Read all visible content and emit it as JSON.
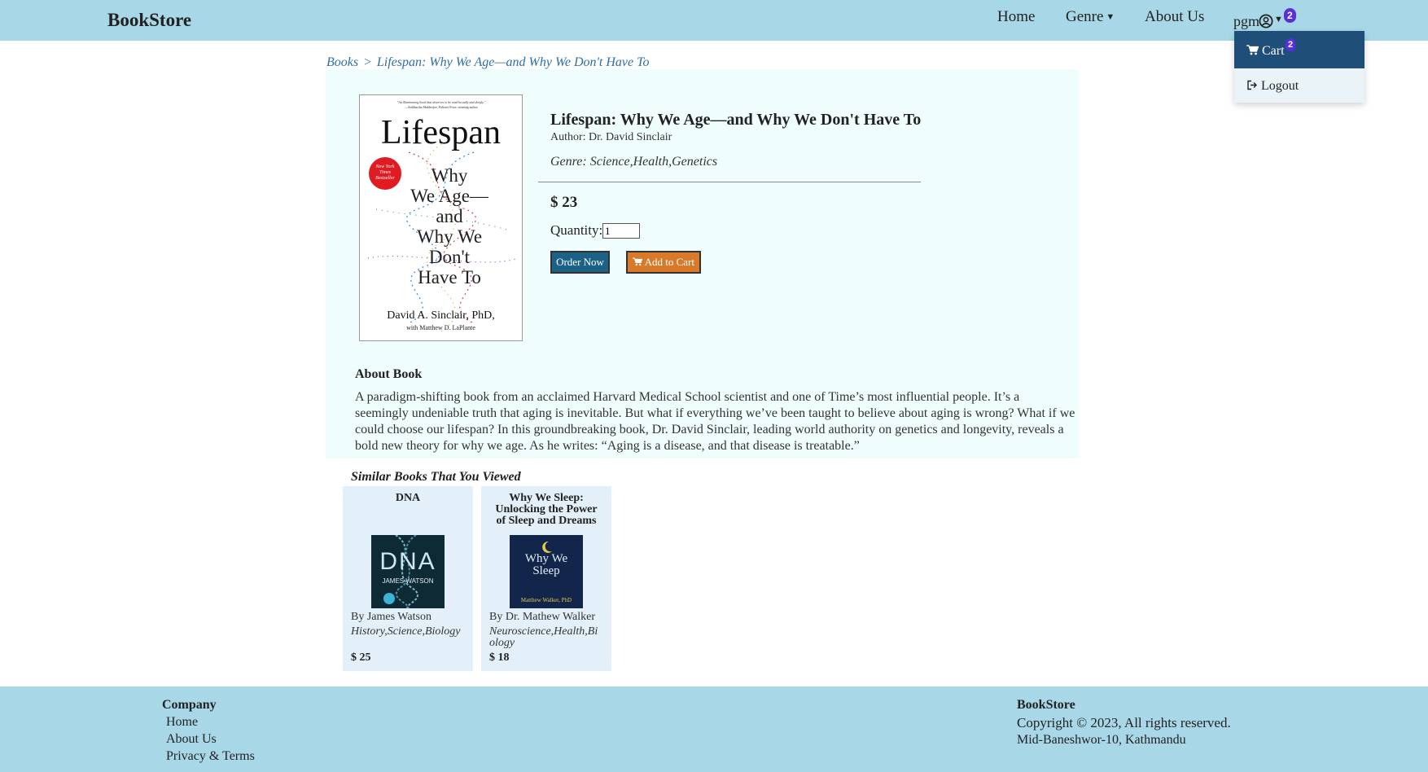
{
  "navbar": {
    "brand": "BookStore",
    "links": {
      "home": "Home",
      "genre": "Genre",
      "about": "About Us"
    },
    "user": "pgm",
    "cart_count": "2"
  },
  "dropdown": {
    "cart_label": "Cart",
    "cart_count": "2",
    "logout_label": "Logout"
  },
  "breadcrumb": {
    "root": "Books",
    "separator": ">",
    "current": "Lifespan: Why We Age—and Why We Don't Have To"
  },
  "book": {
    "title": "Lifespan: Why We Age—and Why We Don't Have To",
    "author": "Author: Dr. David Sinclair",
    "genre": "Genre: Science,Health,Genetics",
    "price": "$ 23",
    "quantity_label": "Quantity:",
    "quantity_value": "1",
    "order_button": "Order Now",
    "cart_button": "Add to Cart",
    "cover": {
      "quote_line1": "\"An illuminating book that deserves to be read broadly and deeply.\"",
      "quote_line2": "—Siddhartha Mukherjee, Pulitzer Prize–winning author",
      "title": "Lifespan",
      "subtitle_lines": [
        "Why",
        "We Age—",
        "and",
        "Why We",
        "Don't",
        "Have To"
      ],
      "badge_lines": [
        "New York",
        "Times",
        "Bestseller"
      ],
      "author": "David A. Sinclair, PhD,",
      "coauthor": "with Matthew D. LaPlante"
    }
  },
  "about": {
    "heading": "About Book",
    "text": "A paradigm-shifting book from an acclaimed Harvard Medical School scientist and one of Time’s most influential people. It’s a seemingly undeniable truth that aging is inevitable. But what if everything we’ve been taught to believe about aging is wrong? What if we could choose our lifespan? In this groundbreaking book, Dr. David Sinclair, leading world authority on genetics and longevity, reveals a bold new theory for why we age. As he writes: “Aging is a disease, and that disease is treatable.”"
  },
  "similar": {
    "heading": "Similar Books That You Viewed",
    "books": [
      {
        "title": "DNA",
        "author": "By James Watson",
        "genre": "History,Science,Biology",
        "price": "$ 25",
        "cover_title": "DNA",
        "cover_author": "JAMES WATSON"
      },
      {
        "title": "Why We Sleep: Unlocking the Power of Sleep and Dreams",
        "author": "By Dr. Mathew Walker",
        "genre": "Neuroscience,Health,Biology",
        "price": "$ 18",
        "cover_title_1": "Why We",
        "cover_title_2": "Sleep",
        "cover_author": "Matthew Walker, PhD"
      }
    ]
  },
  "footer": {
    "company_heading": "Company",
    "links": [
      "Home",
      "About Us",
      "Privacy & Terms"
    ],
    "brand": "BookStore",
    "copyright": "Copyright © 2023, All rights reserved.",
    "address": "Mid-Baneshwor-10, Kathmandu"
  },
  "colors": {
    "navbar": "#a8d8e8",
    "dropdown_active": "#1f4e79",
    "badge": "#5a2de0",
    "order_button": "#1b6286",
    "cart_button": "#d9792a",
    "panel": "#effdfd",
    "card": "#e3f0f9"
  },
  "icons": {
    "genre_caret": "caret-down-icon",
    "user": "user-circle-icon",
    "cart": "shopping-cart-icon",
    "logout": "sign-out-icon"
  }
}
